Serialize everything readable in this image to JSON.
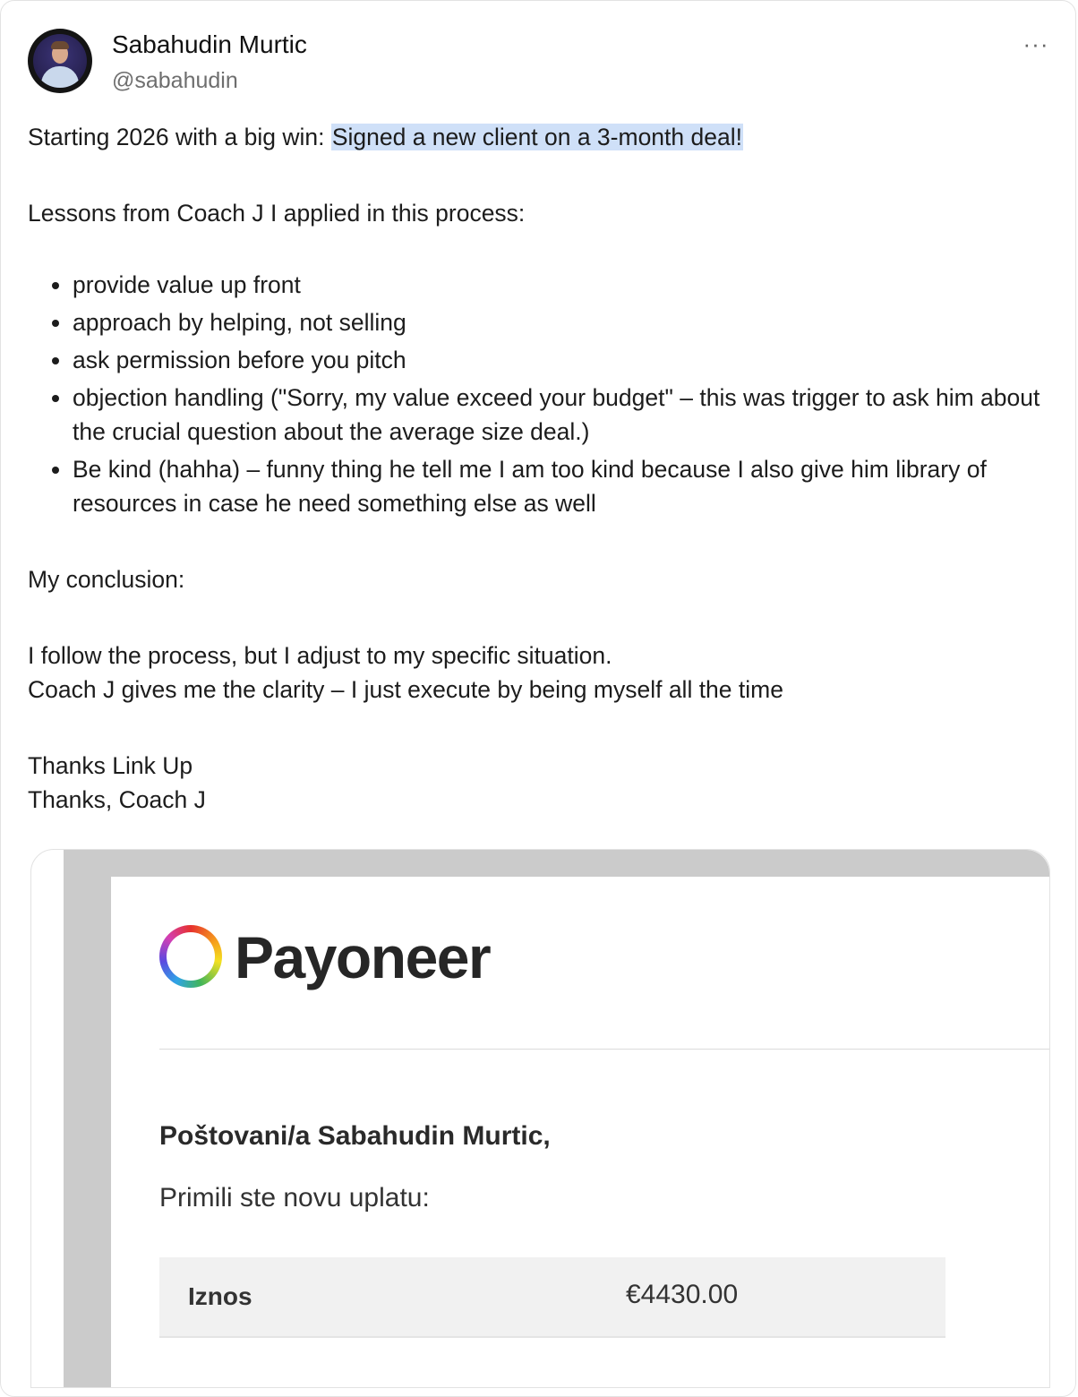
{
  "author": {
    "name": "Sabahudin Murtic",
    "handle": "@sabahudin"
  },
  "menu": {
    "more_icon_label": "···"
  },
  "post": {
    "line1_prefix": "Starting 2026 with a big win: ",
    "line1_highlight": "Signed a new client on a 3-month deal!",
    "lessons_intro": "Lessons from Coach J I applied in this process:",
    "bullets": [
      "provide value up front",
      "approach by helping, not selling",
      "ask permission before you pitch",
      "objection handling (\"Sorry, my value exceed your budget\" – this was trigger to ask him about the crucial question about the average size deal.)",
      "Be kind (hahha) – funny thing he tell me I am too kind because I also give him library of resources in case he need something else as well"
    ],
    "conclusion_title": "My conclusion:",
    "conclusion_line1": "I follow the process, but I adjust to my specific situation.",
    "conclusion_line2": "Coach J gives me the clarity – I just execute by being myself all the time",
    "thanks1": "Thanks Link Up",
    "thanks2": "Thanks, Coach J"
  },
  "image": {
    "brand": "Payoneer",
    "greeting": "Poštovani/a Sabahudin Murtic,",
    "received": "Primili ste novu uplatu:",
    "amount_label": "Iznos",
    "amount_value": "€4430.00"
  }
}
